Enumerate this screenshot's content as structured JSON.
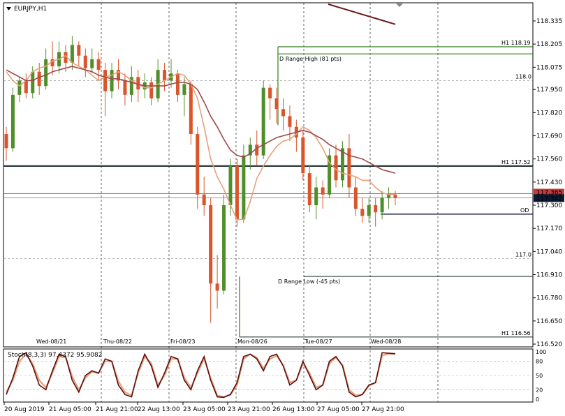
{
  "chart_data": {
    "type": "candlestick",
    "title": "EURJPY,H1",
    "price_axis": {
      "ticks": [
        "118.335",
        "118.205",
        "118.075",
        "117.950",
        "117.820",
        "117.690",
        "117.560",
        "117.430",
        "117.300",
        "117.170",
        "117.040",
        "116.910",
        "116.780",
        "116.650",
        "116.520"
      ],
      "ylim": [
        116.52,
        118.39
      ],
      "current_bid_label": "117.342",
      "current_ask_label": "117.365",
      "current_bid": 117.342,
      "current_ask": 117.365
    },
    "day_separators": [
      "Wed-08/21",
      "Thu-08/22",
      "Fri-08/23",
      "Mon-08/26",
      "Tue-08/27",
      "Wed-08/28"
    ],
    "time_axis": [
      "20 Aug 2019",
      "21 Aug 05:00",
      "21 Aug 21:00",
      "22 Aug 13:00",
      "23 Aug 05:00",
      "23 Aug 21:00",
      "26 Aug 13:00",
      "27 Aug 05:00",
      "27 Aug 21:00"
    ],
    "levels": [
      {
        "label": "H1 118.19",
        "value": 118.19,
        "color": "#2e7d1a"
      },
      {
        "label": "D Range High (81 pts)",
        "value": 118.15,
        "color": "#2e7d1a"
      },
      {
        "label": "118.0",
        "value": 118.0,
        "color": "#888888"
      },
      {
        "label": "H1 117.52",
        "value": 117.52,
        "color": "#2b3a3a"
      },
      {
        "label": "OD",
        "value": 117.25,
        "color": "#1a1a40"
      },
      {
        "label": "117.0",
        "value": 117.0,
        "color": "#888888"
      },
      {
        "label": "D Range Low (-45 pts)",
        "value": 116.9,
        "color": "#2b3a3a"
      },
      {
        "label": "H1 116.56",
        "value": 116.56,
        "color": "#2b3a3a"
      }
    ],
    "moving_averages": [
      {
        "color": "#e8a07a",
        "values": [
          118.05,
          118.0,
          117.97,
          118.0,
          118.05,
          118.07,
          118.08,
          118.11,
          118.12,
          118.14,
          118.1,
          118.08,
          118.06,
          118.03,
          118.0,
          118.02,
          118.03,
          118.05,
          118.03,
          118.0,
          117.98,
          117.96,
          117.96,
          117.98,
          118.0,
          118.02,
          118.04,
          118.03,
          117.98,
          117.9,
          117.74,
          117.56,
          117.46,
          117.39,
          117.3,
          117.22,
          117.22,
          117.32,
          117.45,
          117.52,
          117.58,
          117.63,
          117.66,
          117.67,
          117.7,
          117.74,
          117.72,
          117.68,
          117.62,
          117.54,
          117.5,
          117.48,
          117.47,
          117.46,
          117.44,
          117.44,
          117.4,
          117.37,
          117.36,
          117.36
        ]
      },
      {
        "color": "#a04848",
        "values": [
          118.06,
          118.04,
          118.02,
          118.0,
          118.0,
          118.02,
          118.03,
          118.05,
          118.06,
          118.07,
          118.08,
          118.07,
          118.06,
          118.05,
          118.03,
          118.02,
          118.01,
          118.01,
          118.0,
          117.99,
          117.98,
          117.97,
          117.97,
          117.97,
          117.97,
          117.98,
          117.99,
          117.99,
          117.98,
          117.95,
          117.88,
          117.8,
          117.74,
          117.67,
          117.61,
          117.58,
          117.57,
          117.59,
          117.62,
          117.64,
          117.66,
          117.68,
          117.69,
          117.7,
          117.71,
          117.72,
          117.71,
          117.69,
          117.67,
          117.64,
          117.62,
          117.6,
          117.58,
          117.57,
          117.56,
          117.54,
          117.52,
          117.5,
          117.49,
          117.48
        ]
      },
      {
        "color": "#6b1818",
        "values": [
          118.4,
          118.38,
          118.37,
          118.35,
          118.34,
          118.33,
          118.32
        ]
      }
    ],
    "candles": [
      [
        117.7,
        117.62,
        117.74,
        117.55
      ],
      [
        117.62,
        117.92,
        117.96,
        117.6
      ],
      [
        117.92,
        118.0,
        118.02,
        117.88
      ],
      [
        118.0,
        117.93,
        118.04,
        117.9
      ],
      [
        117.93,
        118.05,
        118.08,
        117.9
      ],
      [
        118.05,
        117.97,
        118.1,
        117.92
      ],
      [
        117.97,
        118.12,
        118.18,
        117.95
      ],
      [
        118.12,
        118.08,
        118.22,
        118.03
      ],
      [
        118.08,
        118.16,
        118.22,
        118.04
      ],
      [
        118.16,
        118.1,
        118.2,
        118.05
      ],
      [
        118.1,
        118.2,
        118.25,
        118.06
      ],
      [
        118.2,
        118.14,
        118.22,
        118.08
      ],
      [
        118.14,
        118.07,
        118.18,
        118.02
      ],
      [
        118.07,
        118.12,
        118.18,
        118.04
      ],
      [
        118.12,
        118.06,
        118.16,
        118.0
      ],
      [
        118.06,
        117.94,
        118.1,
        117.8
      ],
      [
        117.94,
        118.06,
        118.1,
        117.9
      ],
      [
        118.06,
        118.0,
        118.12,
        117.95
      ],
      [
        118.0,
        117.92,
        118.04,
        117.86
      ],
      [
        117.92,
        118.02,
        118.08,
        117.88
      ],
      [
        118.02,
        117.95,
        118.06,
        117.88
      ],
      [
        117.95,
        117.99,
        118.04,
        117.9
      ],
      [
        117.99,
        117.9,
        118.02,
        117.86
      ],
      [
        117.9,
        118.06,
        118.12,
        117.88
      ],
      [
        118.06,
        118.0,
        118.1,
        117.94
      ],
      [
        118.0,
        118.04,
        118.12,
        117.96
      ],
      [
        118.04,
        117.92,
        118.06,
        117.88
      ],
      [
        117.92,
        117.98,
        118.02,
        117.8
      ],
      [
        117.98,
        117.7,
        118.0,
        117.64
      ],
      [
        117.7,
        117.36,
        117.74,
        117.28
      ],
      [
        117.36,
        117.3,
        117.46,
        117.24
      ],
      [
        117.3,
        116.86,
        117.34,
        116.64
      ],
      [
        116.86,
        116.82,
        117.02,
        116.72
      ],
      [
        116.82,
        117.3,
        117.36,
        116.8
      ],
      [
        117.3,
        117.52,
        117.56,
        117.24
      ],
      [
        117.52,
        117.22,
        117.56,
        117.18
      ],
      [
        117.22,
        117.58,
        117.64,
        117.2
      ],
      [
        117.58,
        117.64,
        117.68,
        117.5
      ],
      [
        117.64,
        117.58,
        117.72,
        117.52
      ],
      [
        117.58,
        117.96,
        118.0,
        117.56
      ],
      [
        117.96,
        117.9,
        117.98,
        117.78
      ],
      [
        117.9,
        117.84,
        117.96,
        117.76
      ],
      [
        117.84,
        117.8,
        117.9,
        117.72
      ],
      [
        117.8,
        117.74,
        117.86,
        117.66
      ],
      [
        117.74,
        117.68,
        117.78,
        117.6
      ],
      [
        117.68,
        117.48,
        117.72,
        117.44
      ],
      [
        117.48,
        117.3,
        117.52,
        117.26
      ],
      [
        117.3,
        117.4,
        117.46,
        117.22
      ],
      [
        117.4,
        117.36,
        117.44,
        117.28
      ],
      [
        117.36,
        117.58,
        117.62,
        117.34
      ],
      [
        117.58,
        117.44,
        117.64,
        117.4
      ],
      [
        117.44,
        117.62,
        117.66,
        117.4
      ],
      [
        117.62,
        117.4,
        117.7,
        117.34
      ],
      [
        117.4,
        117.28,
        117.46,
        117.24
      ],
      [
        117.28,
        117.24,
        117.34,
        117.2
      ],
      [
        117.24,
        117.3,
        117.34,
        117.2
      ],
      [
        117.3,
        117.26,
        117.34,
        117.18
      ],
      [
        117.26,
        117.34,
        117.38,
        117.22
      ],
      [
        117.34,
        117.36,
        117.4,
        117.28
      ],
      [
        117.36,
        117.34,
        117.38,
        117.3
      ]
    ],
    "stochastic": {
      "label": "Stoch(8,3,3) 97.4372 95.9082",
      "ticks": [
        "100",
        "80",
        "50",
        "20",
        "0"
      ],
      "k_values": [
        10,
        45,
        90,
        98,
        70,
        30,
        20,
        60,
        95,
        90,
        40,
        15,
        50,
        60,
        55,
        85,
        80,
        30,
        10,
        5,
        60,
        95,
        70,
        25,
        55,
        90,
        85,
        40,
        20,
        60,
        90,
        40,
        5,
        4,
        10,
        35,
        90,
        95,
        85,
        60,
        90,
        95,
        70,
        30,
        40,
        80,
        50,
        20,
        30,
        80,
        90,
        70,
        15,
        5,
        10,
        30,
        35,
        98,
        97,
        96
      ],
      "d_values": [
        15,
        40,
        80,
        95,
        75,
        40,
        25,
        55,
        90,
        88,
        48,
        20,
        45,
        58,
        55,
        80,
        80,
        38,
        15,
        8,
        55,
        90,
        75,
        30,
        50,
        85,
        85,
        45,
        25,
        55,
        85,
        45,
        8,
        5,
        10,
        30,
        85,
        95,
        88,
        65,
        85,
        92,
        72,
        35,
        40,
        75,
        55,
        25,
        30,
        75,
        88,
        72,
        20,
        8,
        10,
        28,
        35,
        92,
        96,
        95
      ]
    }
  }
}
